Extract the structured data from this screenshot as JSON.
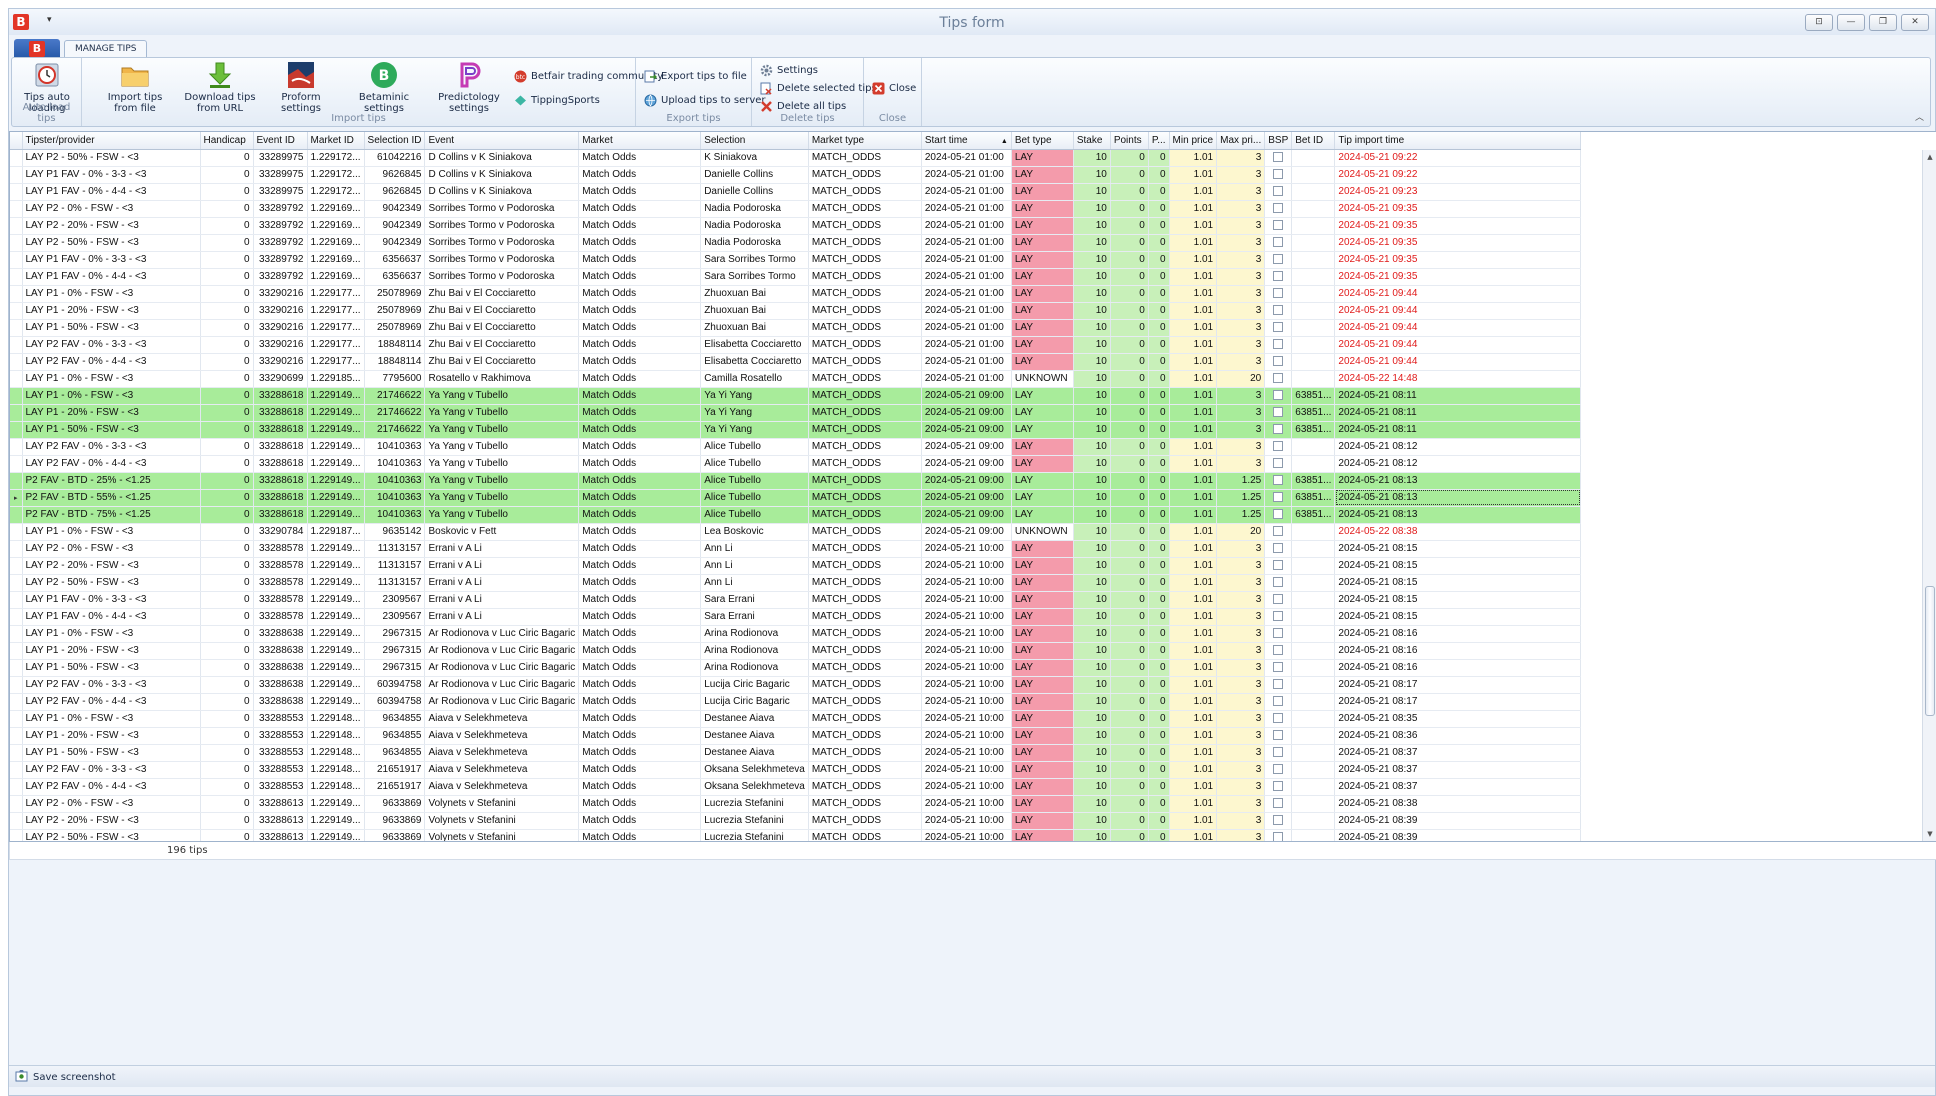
{
  "app": {
    "title": "Tips form",
    "logo": "B",
    "quick_access": "▾"
  },
  "tabs": {
    "logo_letter": "B",
    "manage": "MANAGE TIPS"
  },
  "window_buttons": [
    "⊡",
    "—",
    "❐",
    "✕"
  ],
  "ribbon": {
    "auto_load": {
      "group": "Auto load tips",
      "btn": "Tips auto loading"
    },
    "import": {
      "group": "Import tips",
      "from_file": "Import tips from file",
      "from_url": "Download tips from URL",
      "proform": "Proform settings",
      "betaminic": "Betaminic settings",
      "predictology": "Predictology settings",
      "betfair": "Betfair trading community",
      "tippingsports": "TippingSports"
    },
    "export": {
      "group": "Export tips",
      "to_file": "Export tips to file",
      "upload": "Upload tips to server"
    },
    "delete": {
      "group": "Delete tips",
      "settings": "Settings",
      "selected": "Delete selected tips",
      "all": "Delete all tips"
    },
    "close": {
      "group": "Close",
      "btn": "Close"
    },
    "colors": {
      "accent": "#e23527",
      "green_row": "#a8ec9a",
      "bet_type_bg": "#f49bab",
      "stake_bg": "#c8f0b9",
      "price_bg": "#fdf7cf",
      "red_text": "#e01a1a"
    }
  },
  "grid": {
    "columns": [
      "",
      "Tipster/provider",
      "Handicap",
      "Event ID",
      "Market ID",
      "Selection ID",
      "Event",
      "Market",
      "Selection",
      "Market type",
      "Start time",
      "Bet type",
      "Stake",
      "Points",
      "P...",
      "Min price",
      "Max pri...",
      "BSP",
      "Bet ID",
      "Tip import time"
    ],
    "sort_indicator": "▲",
    "rows": [
      [
        "LAY P2 - 50% - FSW - <3",
        "0",
        "33289975",
        "1.229172...",
        "61042216",
        "D Collins v K Siniakova",
        "Match Odds",
        "K Siniakova",
        "MATCH_ODDS",
        "2024-05-21 01:00",
        "LAY",
        "10",
        "0",
        "0",
        "1.01",
        "3",
        "",
        "2024-05-21 09:22"
      ],
      [
        "LAY P1 FAV - 0% - 3-3 - <3",
        "0",
        "33289975",
        "1.229172...",
        "9626845",
        "D Collins v K Siniakova",
        "Match Odds",
        "Danielle Collins",
        "MATCH_ODDS",
        "2024-05-21 01:00",
        "LAY",
        "10",
        "0",
        "0",
        "1.01",
        "3",
        "",
        "2024-05-21 09:22"
      ],
      [
        "LAY P1 FAV - 0% - 4-4 - <3",
        "0",
        "33289975",
        "1.229172...",
        "9626845",
        "D Collins v K Siniakova",
        "Match Odds",
        "Danielle Collins",
        "MATCH_ODDS",
        "2024-05-21 01:00",
        "LAY",
        "10",
        "0",
        "0",
        "1.01",
        "3",
        "",
        "2024-05-21 09:23"
      ],
      [
        "LAY P2 - 0% - FSW - <3",
        "0",
        "33289792",
        "1.229169...",
        "9042349",
        "Sorribes Tormo v Podoroska",
        "Match Odds",
        "Nadia Podoroska",
        "MATCH_ODDS",
        "2024-05-21 01:00",
        "LAY",
        "10",
        "0",
        "0",
        "1.01",
        "3",
        "",
        "2024-05-21 09:35"
      ],
      [
        "LAY P2 - 20% - FSW - <3",
        "0",
        "33289792",
        "1.229169...",
        "9042349",
        "Sorribes Tormo v Podoroska",
        "Match Odds",
        "Nadia Podoroska",
        "MATCH_ODDS",
        "2024-05-21 01:00",
        "LAY",
        "10",
        "0",
        "0",
        "1.01",
        "3",
        "",
        "2024-05-21 09:35"
      ],
      [
        "LAY P2 - 50% - FSW - <3",
        "0",
        "33289792",
        "1.229169...",
        "9042349",
        "Sorribes Tormo v Podoroska",
        "Match Odds",
        "Nadia Podoroska",
        "MATCH_ODDS",
        "2024-05-21 01:00",
        "LAY",
        "10",
        "0",
        "0",
        "1.01",
        "3",
        "",
        "2024-05-21 09:35"
      ],
      [
        "LAY P1 FAV - 0% - 3-3 - <3",
        "0",
        "33289792",
        "1.229169...",
        "6356637",
        "Sorribes Tormo v Podoroska",
        "Match Odds",
        "Sara Sorribes Tormo",
        "MATCH_ODDS",
        "2024-05-21 01:00",
        "LAY",
        "10",
        "0",
        "0",
        "1.01",
        "3",
        "",
        "2024-05-21 09:35"
      ],
      [
        "LAY P1 FAV - 0% - 4-4 - <3",
        "0",
        "33289792",
        "1.229169...",
        "6356637",
        "Sorribes Tormo v Podoroska",
        "Match Odds",
        "Sara Sorribes Tormo",
        "MATCH_ODDS",
        "2024-05-21 01:00",
        "LAY",
        "10",
        "0",
        "0",
        "1.01",
        "3",
        "",
        "2024-05-21 09:35"
      ],
      [
        "LAY P1 - 0% - FSW - <3",
        "0",
        "33290216",
        "1.229177...",
        "25078969",
        "Zhu Bai v El Cocciaretto",
        "Match Odds",
        "Zhuoxuan Bai",
        "MATCH_ODDS",
        "2024-05-21 01:00",
        "LAY",
        "10",
        "0",
        "0",
        "1.01",
        "3",
        "",
        "2024-05-21 09:44"
      ],
      [
        "LAY P1 - 20% - FSW - <3",
        "0",
        "33290216",
        "1.229177...",
        "25078969",
        "Zhu Bai v El Cocciaretto",
        "Match Odds",
        "Zhuoxuan Bai",
        "MATCH_ODDS",
        "2024-05-21 01:00",
        "LAY",
        "10",
        "0",
        "0",
        "1.01",
        "3",
        "",
        "2024-05-21 09:44"
      ],
      [
        "LAY P1 - 50% - FSW - <3",
        "0",
        "33290216",
        "1.229177...",
        "25078969",
        "Zhu Bai v El Cocciaretto",
        "Match Odds",
        "Zhuoxuan Bai",
        "MATCH_ODDS",
        "2024-05-21 01:00",
        "LAY",
        "10",
        "0",
        "0",
        "1.01",
        "3",
        "",
        "2024-05-21 09:44"
      ],
      [
        "LAY P2 FAV - 0% - 3-3 - <3",
        "0",
        "33290216",
        "1.229177...",
        "18848114",
        "Zhu Bai v El Cocciaretto",
        "Match Odds",
        "Elisabetta Cocciaretto",
        "MATCH_ODDS",
        "2024-05-21 01:00",
        "LAY",
        "10",
        "0",
        "0",
        "1.01",
        "3",
        "",
        "2024-05-21 09:44"
      ],
      [
        "LAY P2 FAV - 0% - 4-4 - <3",
        "0",
        "33290216",
        "1.229177...",
        "18848114",
        "Zhu Bai v El Cocciaretto",
        "Match Odds",
        "Elisabetta Cocciaretto",
        "MATCH_ODDS",
        "2024-05-21 01:00",
        "LAY",
        "10",
        "0",
        "0",
        "1.01",
        "3",
        "",
        "2024-05-21 09:44"
      ],
      [
        "LAY P1 - 0% - FSW - <3",
        "0",
        "33290699",
        "1.229185...",
        "7795600",
        "Rosatello v Rakhimova",
        "Match Odds",
        "Camilla Rosatello",
        "MATCH_ODDS",
        "2024-05-21 01:00",
        "UNKNOWN",
        "10",
        "0",
        "0",
        "1.01",
        "20",
        "",
        "2024-05-22 14:48"
      ],
      [
        "LAY P1 - 0% - FSW - <3",
        "0",
        "33288618",
        "1.229149...",
        "21746622",
        "Ya Yang v Tubello",
        "Match Odds",
        "Ya Yi Yang",
        "MATCH_ODDS",
        "2024-05-21 09:00",
        "LAY",
        "10",
        "0",
        "0",
        "1.01",
        "3",
        "63851...",
        "2024-05-21 08:11"
      ],
      [
        "LAY P1 - 20% - FSW - <3",
        "0",
        "33288618",
        "1.229149...",
        "21746622",
        "Ya Yang v Tubello",
        "Match Odds",
        "Ya Yi Yang",
        "MATCH_ODDS",
        "2024-05-21 09:00",
        "LAY",
        "10",
        "0",
        "0",
        "1.01",
        "3",
        "63851...",
        "2024-05-21 08:11"
      ],
      [
        "LAY P1 - 50% - FSW - <3",
        "0",
        "33288618",
        "1.229149...",
        "21746622",
        "Ya Yang v Tubello",
        "Match Odds",
        "Ya Yi Yang",
        "MATCH_ODDS",
        "2024-05-21 09:00",
        "LAY",
        "10",
        "0",
        "0",
        "1.01",
        "3",
        "63851...",
        "2024-05-21 08:11"
      ],
      [
        "LAY P2 FAV - 0% - 3-3 - <3",
        "0",
        "33288618",
        "1.229149...",
        "10410363",
        "Ya Yang v Tubello",
        "Match Odds",
        "Alice Tubello",
        "MATCH_ODDS",
        "2024-05-21 09:00",
        "LAY",
        "10",
        "0",
        "0",
        "1.01",
        "3",
        "",
        "2024-05-21 08:12"
      ],
      [
        "LAY P2 FAV - 0% - 4-4 - <3",
        "0",
        "33288618",
        "1.229149...",
        "10410363",
        "Ya Yang v Tubello",
        "Match Odds",
        "Alice Tubello",
        "MATCH_ODDS",
        "2024-05-21 09:00",
        "LAY",
        "10",
        "0",
        "0",
        "1.01",
        "3",
        "",
        "2024-05-21 08:12"
      ],
      [
        "P2 FAV - BTD - 25% - <1.25",
        "0",
        "33288618",
        "1.229149...",
        "10410363",
        "Ya Yang v Tubello",
        "Match Odds",
        "Alice Tubello",
        "MATCH_ODDS",
        "2024-05-21 09:00",
        "LAY",
        "10",
        "0",
        "0",
        "1.01",
        "1.25",
        "63851...",
        "2024-05-21 08:13"
      ],
      [
        "P2 FAV - BTD - 55% - <1.25",
        "0",
        "33288618",
        "1.229149...",
        "10410363",
        "Ya Yang v Tubello",
        "Match Odds",
        "Alice Tubello",
        "MATCH_ODDS",
        "2024-05-21 09:00",
        "LAY",
        "10",
        "0",
        "0",
        "1.01",
        "1.25",
        "63851...",
        "2024-05-21 08:13"
      ],
      [
        "P2 FAV - BTD - 75% - <1.25",
        "0",
        "33288618",
        "1.229149...",
        "10410363",
        "Ya Yang v Tubello",
        "Match Odds",
        "Alice Tubello",
        "MATCH_ODDS",
        "2024-05-21 09:00",
        "LAY",
        "10",
        "0",
        "0",
        "1.01",
        "1.25",
        "63851...",
        "2024-05-21 08:13"
      ],
      [
        "LAY P1 - 0% - FSW - <3",
        "0",
        "33290784",
        "1.229187...",
        "9635142",
        "Boskovic v Fett",
        "Match Odds",
        "Lea Boskovic",
        "MATCH_ODDS",
        "2024-05-21 09:00",
        "UNKNOWN",
        "10",
        "0",
        "0",
        "1.01",
        "20",
        "",
        "2024-05-22 08:38"
      ],
      [
        "LAY P2 - 0% - FSW - <3",
        "0",
        "33288578",
        "1.229149...",
        "11313157",
        "Errani v A Li",
        "Match Odds",
        "Ann Li",
        "MATCH_ODDS",
        "2024-05-21 10:00",
        "LAY",
        "10",
        "0",
        "0",
        "1.01",
        "3",
        "",
        "2024-05-21 08:15"
      ],
      [
        "LAY P2 - 20% - FSW - <3",
        "0",
        "33288578",
        "1.229149...",
        "11313157",
        "Errani v A Li",
        "Match Odds",
        "Ann Li",
        "MATCH_ODDS",
        "2024-05-21 10:00",
        "LAY",
        "10",
        "0",
        "0",
        "1.01",
        "3",
        "",
        "2024-05-21 08:15"
      ],
      [
        "LAY P2 - 50% - FSW - <3",
        "0",
        "33288578",
        "1.229149...",
        "11313157",
        "Errani v A Li",
        "Match Odds",
        "Ann Li",
        "MATCH_ODDS",
        "2024-05-21 10:00",
        "LAY",
        "10",
        "0",
        "0",
        "1.01",
        "3",
        "",
        "2024-05-21 08:15"
      ],
      [
        "LAY P1 FAV - 0% - 3-3 - <3",
        "0",
        "33288578",
        "1.229149...",
        "2309567",
        "Errani v A Li",
        "Match Odds",
        "Sara Errani",
        "MATCH_ODDS",
        "2024-05-21 10:00",
        "LAY",
        "10",
        "0",
        "0",
        "1.01",
        "3",
        "",
        "2024-05-21 08:15"
      ],
      [
        "LAY P1 FAV - 0% - 4-4 - <3",
        "0",
        "33288578",
        "1.229149...",
        "2309567",
        "Errani v A Li",
        "Match Odds",
        "Sara Errani",
        "MATCH_ODDS",
        "2024-05-21 10:00",
        "LAY",
        "10",
        "0",
        "0",
        "1.01",
        "3",
        "",
        "2024-05-21 08:15"
      ],
      [
        "LAY P1 - 0% - FSW - <3",
        "0",
        "33288638",
        "1.229149...",
        "2967315",
        "Ar Rodionova v Luc Ciric Bagaric",
        "Match Odds",
        "Arina Rodionova",
        "MATCH_ODDS",
        "2024-05-21 10:00",
        "LAY",
        "10",
        "0",
        "0",
        "1.01",
        "3",
        "",
        "2024-05-21 08:16"
      ],
      [
        "LAY P1 - 20% - FSW - <3",
        "0",
        "33288638",
        "1.229149...",
        "2967315",
        "Ar Rodionova v Luc Ciric Bagaric",
        "Match Odds",
        "Arina Rodionova",
        "MATCH_ODDS",
        "2024-05-21 10:00",
        "LAY",
        "10",
        "0",
        "0",
        "1.01",
        "3",
        "",
        "2024-05-21 08:16"
      ],
      [
        "LAY P1 - 50% - FSW - <3",
        "0",
        "33288638",
        "1.229149...",
        "2967315",
        "Ar Rodionova v Luc Ciric Bagaric",
        "Match Odds",
        "Arina Rodionova",
        "MATCH_ODDS",
        "2024-05-21 10:00",
        "LAY",
        "10",
        "0",
        "0",
        "1.01",
        "3",
        "",
        "2024-05-21 08:16"
      ],
      [
        "LAY P2 FAV - 0% - 3-3 - <3",
        "0",
        "33288638",
        "1.229149...",
        "60394758",
        "Ar Rodionova v Luc Ciric Bagaric",
        "Match Odds",
        "Lucija Ciric Bagaric",
        "MATCH_ODDS",
        "2024-05-21 10:00",
        "LAY",
        "10",
        "0",
        "0",
        "1.01",
        "3",
        "",
        "2024-05-21 08:17"
      ],
      [
        "LAY P2 FAV - 0% - 4-4 - <3",
        "0",
        "33288638",
        "1.229149...",
        "60394758",
        "Ar Rodionova v Luc Ciric Bagaric",
        "Match Odds",
        "Lucija Ciric Bagaric",
        "MATCH_ODDS",
        "2024-05-21 10:00",
        "LAY",
        "10",
        "0",
        "0",
        "1.01",
        "3",
        "",
        "2024-05-21 08:17"
      ],
      [
        "LAY P1 - 0% - FSW - <3",
        "0",
        "33288553",
        "1.229148...",
        "9634855",
        "Aiava v Selekhmeteva",
        "Match Odds",
        "Destanee Aiava",
        "MATCH_ODDS",
        "2024-05-21 10:00",
        "LAY",
        "10",
        "0",
        "0",
        "1.01",
        "3",
        "",
        "2024-05-21 08:35"
      ],
      [
        "LAY P1 - 20% - FSW - <3",
        "0",
        "33288553",
        "1.229148...",
        "9634855",
        "Aiava v Selekhmeteva",
        "Match Odds",
        "Destanee Aiava",
        "MATCH_ODDS",
        "2024-05-21 10:00",
        "LAY",
        "10",
        "0",
        "0",
        "1.01",
        "3",
        "",
        "2024-05-21 08:36"
      ],
      [
        "LAY P1 - 50% - FSW - <3",
        "0",
        "33288553",
        "1.229148...",
        "9634855",
        "Aiava v Selekhmeteva",
        "Match Odds",
        "Destanee Aiava",
        "MATCH_ODDS",
        "2024-05-21 10:00",
        "LAY",
        "10",
        "0",
        "0",
        "1.01",
        "3",
        "",
        "2024-05-21 08:37"
      ],
      [
        "LAY P2 FAV - 0% - 3-3 - <3",
        "0",
        "33288553",
        "1.229148...",
        "21651917",
        "Aiava v Selekhmeteva",
        "Match Odds",
        "Oksana Selekhmeteva",
        "MATCH_ODDS",
        "2024-05-21 10:00",
        "LAY",
        "10",
        "0",
        "0",
        "1.01",
        "3",
        "",
        "2024-05-21 08:37"
      ],
      [
        "LAY P2 FAV - 0% - 4-4 - <3",
        "0",
        "33288553",
        "1.229148...",
        "21651917",
        "Aiava v Selekhmeteva",
        "Match Odds",
        "Oksana Selekhmeteva",
        "MATCH_ODDS",
        "2024-05-21 10:00",
        "LAY",
        "10",
        "0",
        "0",
        "1.01",
        "3",
        "",
        "2024-05-21 08:37"
      ],
      [
        "LAY P2 - 0% - FSW - <3",
        "0",
        "33288613",
        "1.229149...",
        "9633869",
        "Volynets v Stefanini",
        "Match Odds",
        "Lucrezia Stefanini",
        "MATCH_ODDS",
        "2024-05-21 10:00",
        "LAY",
        "10",
        "0",
        "0",
        "1.01",
        "3",
        "",
        "2024-05-21 08:38"
      ],
      [
        "LAY P2 - 20% - FSW - <3",
        "0",
        "33288613",
        "1.229149...",
        "9633869",
        "Volynets v Stefanini",
        "Match Odds",
        "Lucrezia Stefanini",
        "MATCH_ODDS",
        "2024-05-21 10:00",
        "LAY",
        "10",
        "0",
        "0",
        "1.01",
        "3",
        "",
        "2024-05-21 08:39"
      ],
      [
        "LAY P2 - 50% - FSW - <3",
        "0",
        "33288613",
        "1.229149...",
        "9633869",
        "Volynets v Stefanini",
        "Match Odds",
        "Lucrezia Stefanini",
        "MATCH_ODDS",
        "2024-05-21 10:00",
        "LAY",
        "10",
        "0",
        "0",
        "1.01",
        "3",
        "",
        "2024-05-21 08:39"
      ]
    ],
    "green_rows": [
      14,
      15,
      16,
      19,
      20,
      21
    ],
    "red_time_rows": [
      0,
      1,
      2,
      3,
      4,
      5,
      6,
      7,
      8,
      9,
      10,
      11,
      12,
      13,
      22
    ],
    "selected_row": 20,
    "current_row_marker": "▸",
    "footer_count": "196 tips"
  },
  "scrollbar": {
    "up": "▲",
    "down": "▼"
  },
  "status": {
    "save_screenshot": "Save screenshot"
  }
}
